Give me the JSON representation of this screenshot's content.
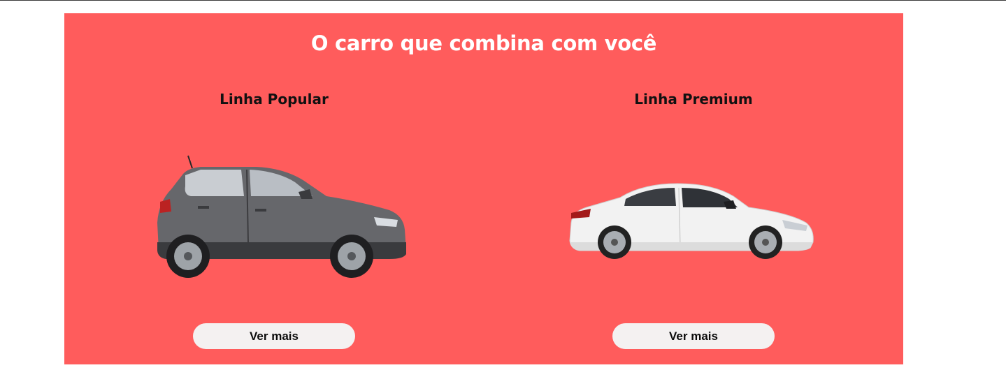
{
  "colors": {
    "panel_background": "#ff5c5c",
    "title_text": "#ffffff",
    "button_background": "#f4f1f1"
  },
  "section": {
    "title": "O carro que combina com você"
  },
  "cards": [
    {
      "title": "Linha Popular",
      "image": "grey-hatchback-car",
      "button_label": "Ver mais"
    },
    {
      "title": "Linha Premium",
      "image": "white-sedan-car",
      "button_label": "Ver mais"
    }
  ]
}
